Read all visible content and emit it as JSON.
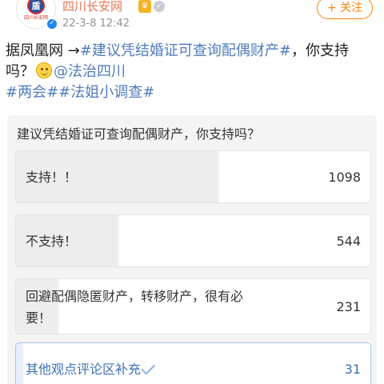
{
  "header": {
    "avatar_text": "四川长安网",
    "account_name": "四川长安网",
    "post_time": "22-3-8 12:42",
    "follow_label": "+ 关注"
  },
  "post": {
    "line1_prefix": "据凤凰网 →",
    "line1_topic": "#建议凭结婚证可查询配偶财产#",
    "line1_suffix": "，你支持",
    "line2_prefix": "吗？",
    "line2_mention": "@法治四川",
    "line3_topics": "#两会##法姐小调查#"
  },
  "poll": {
    "question": "建议凭结婚证可查询配偶财产，你支持吗？",
    "options": [
      {
        "label": "支持！！",
        "count": "1098",
        "fraction": 0.57
      },
      {
        "label": "不支持！",
        "count": "544",
        "fraction": 0.29
      },
      {
        "label_line1": "回避配偶隐匿财产，转移财产，很有必",
        "label_line2": "要！",
        "count": "231",
        "fraction": 0.12
      },
      {
        "label": "其他观点评论区补充",
        "count": "31",
        "fraction": 0.02
      }
    ]
  },
  "icons": {
    "avatar": "police-emblem-icon",
    "crown": "crown-icon",
    "member": "member-badge-icon",
    "verified": "verified-badge-icon",
    "emoji": "smile-icon",
    "selected": "check-icon"
  },
  "colors": {
    "account_name": "#eb7350",
    "follow_accent": "#ff8200",
    "link_blue": "#4f7bbd",
    "poll_background": "#f4f4f4",
    "poll_fill": "#ededed"
  }
}
